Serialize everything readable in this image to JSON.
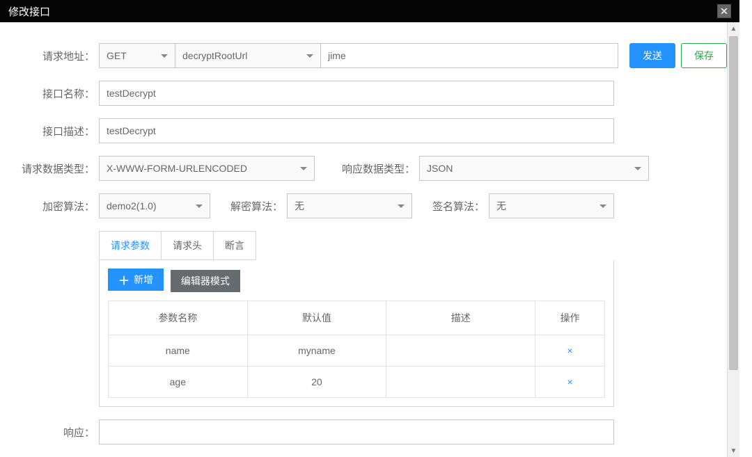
{
  "modal": {
    "title": "修改接口"
  },
  "labels": {
    "request_url": "请求地址：",
    "interface_name": "接口名称：",
    "interface_desc": "接口描述：",
    "request_data_type": "请求数据类型：",
    "response_data_type": "响应数据类型：",
    "encrypt_algo": "加密算法：",
    "decrypt_algo": "解密算法：",
    "sign_algo": "签名算法：",
    "response": "响应："
  },
  "form": {
    "method": "GET",
    "root_url": "decryptRootUrl",
    "url_suffix": "jime",
    "interface_name": "testDecrypt",
    "interface_desc": "testDecrypt",
    "request_data_type": "X-WWW-FORM-URLENCODED",
    "response_data_type": "JSON",
    "encrypt_algo": "demo2(1.0)",
    "decrypt_algo": "无",
    "sign_algo": "无",
    "response": ""
  },
  "buttons": {
    "send": "发送",
    "save": "保存",
    "add": "新增",
    "editor_mode": "编辑器模式"
  },
  "tabs": {
    "request_params": "请求参数",
    "request_headers": "请求头",
    "assertions": "断言"
  },
  "table": {
    "headers": {
      "name": "参数名称",
      "default": "默认值",
      "desc": "描述",
      "action": "操作"
    },
    "rows": [
      {
        "name": "name",
        "default": "myname",
        "desc": ""
      },
      {
        "name": "age",
        "default": "20",
        "desc": ""
      }
    ],
    "delete_symbol": "×"
  }
}
